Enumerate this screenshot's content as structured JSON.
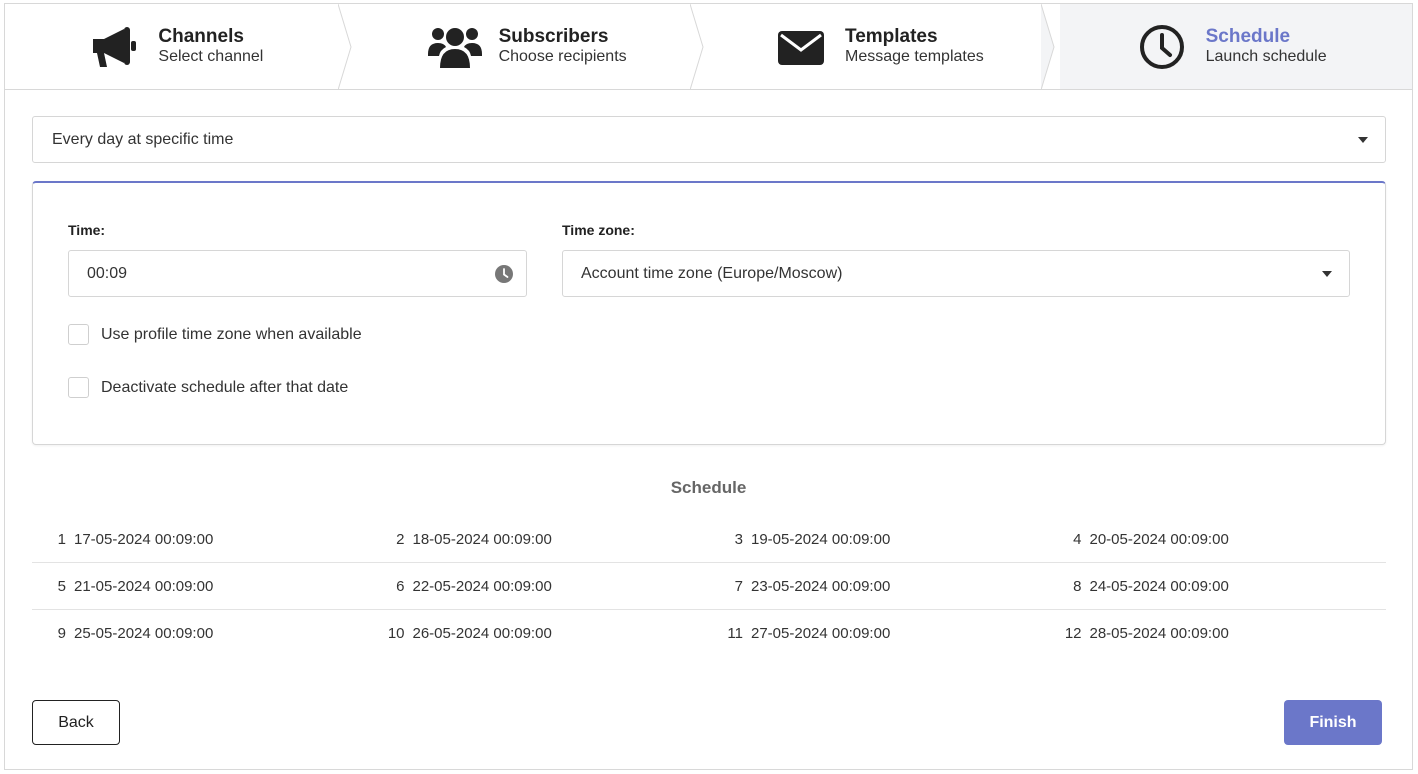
{
  "stepper": {
    "steps": [
      {
        "title": "Channels",
        "subtitle": "Select channel",
        "icon": "megaphone-icon",
        "active": false
      },
      {
        "title": "Subscribers",
        "subtitle": "Choose recipients",
        "icon": "users-icon",
        "active": false
      },
      {
        "title": "Templates",
        "subtitle": "Message templates",
        "icon": "envelope-icon",
        "active": false
      },
      {
        "title": "Schedule",
        "subtitle": "Launch schedule",
        "icon": "clock-icon",
        "active": true
      }
    ]
  },
  "frequency": {
    "selected": "Every day at specific time"
  },
  "settings": {
    "time_label": "Time:",
    "time_value": "00:09",
    "timezone_label": "Time zone:",
    "timezone_value": "Account time zone (Europe/Moscow)",
    "use_profile_tz_label": "Use profile time zone when available",
    "deactivate_label": "Deactivate schedule after that date"
  },
  "schedule": {
    "title": "Schedule",
    "rows": [
      [
        {
          "num": "1",
          "datetime": "17-05-2024 00:09:00"
        },
        {
          "num": "2",
          "datetime": "18-05-2024 00:09:00"
        },
        {
          "num": "3",
          "datetime": "19-05-2024 00:09:00"
        },
        {
          "num": "4",
          "datetime": "20-05-2024 00:09:00"
        }
      ],
      [
        {
          "num": "5",
          "datetime": "21-05-2024 00:09:00"
        },
        {
          "num": "6",
          "datetime": "22-05-2024 00:09:00"
        },
        {
          "num": "7",
          "datetime": "23-05-2024 00:09:00"
        },
        {
          "num": "8",
          "datetime": "24-05-2024 00:09:00"
        }
      ],
      [
        {
          "num": "9",
          "datetime": "25-05-2024 00:09:00"
        },
        {
          "num": "10",
          "datetime": "26-05-2024 00:09:00"
        },
        {
          "num": "11",
          "datetime": "27-05-2024 00:09:00"
        },
        {
          "num": "12",
          "datetime": "28-05-2024 00:09:00"
        }
      ]
    ]
  },
  "actions": {
    "back_label": "Back",
    "finish_label": "Finish"
  },
  "colors": {
    "accent": "#6b77c9",
    "active_step_bg": "#f3f4f6",
    "text": "#222222",
    "border": "#d6d6d6"
  }
}
